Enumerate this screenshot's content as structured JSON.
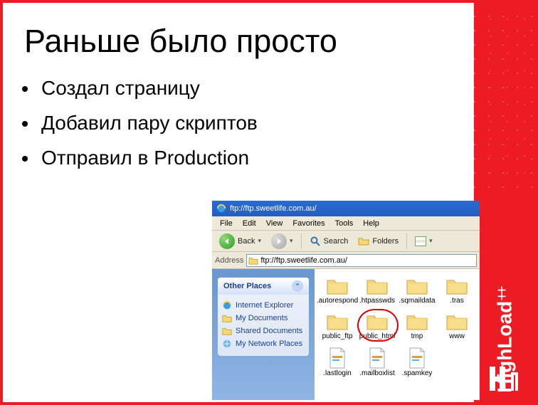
{
  "brand": {
    "name": "HighLoad",
    "plus": "++"
  },
  "slide": {
    "title": "Раньше было просто",
    "bullets": [
      "Создал страницу",
      "Добавил пару скриптов",
      "Отправил в Production"
    ]
  },
  "ftp": {
    "window_title": "ftp://ftp.sweetlife.com.au/",
    "menu": {
      "file": "File",
      "edit": "Edit",
      "view": "View",
      "favorites": "Favorites",
      "tools": "Tools",
      "help": "Help"
    },
    "toolbar": {
      "back": "Back",
      "search": "Search",
      "folders": "Folders"
    },
    "address_label": "Address",
    "address_value": "ftp://ftp.sweetlife.com.au/",
    "sidepanel": {
      "heading": "Other Places",
      "items": [
        "Internet Explorer",
        "My Documents",
        "Shared Documents",
        "My Network Places"
      ]
    },
    "files": {
      "row1": [
        ".autorespond",
        ".htpasswds",
        ".sqmaildata",
        ".tras"
      ],
      "row2": [
        "public_ftp",
        "public_html",
        "tmp",
        "www"
      ],
      "row3": [
        ".lastlogin",
        ".mailboxlist",
        ".spamkey"
      ],
      "circled": "public_html"
    }
  }
}
